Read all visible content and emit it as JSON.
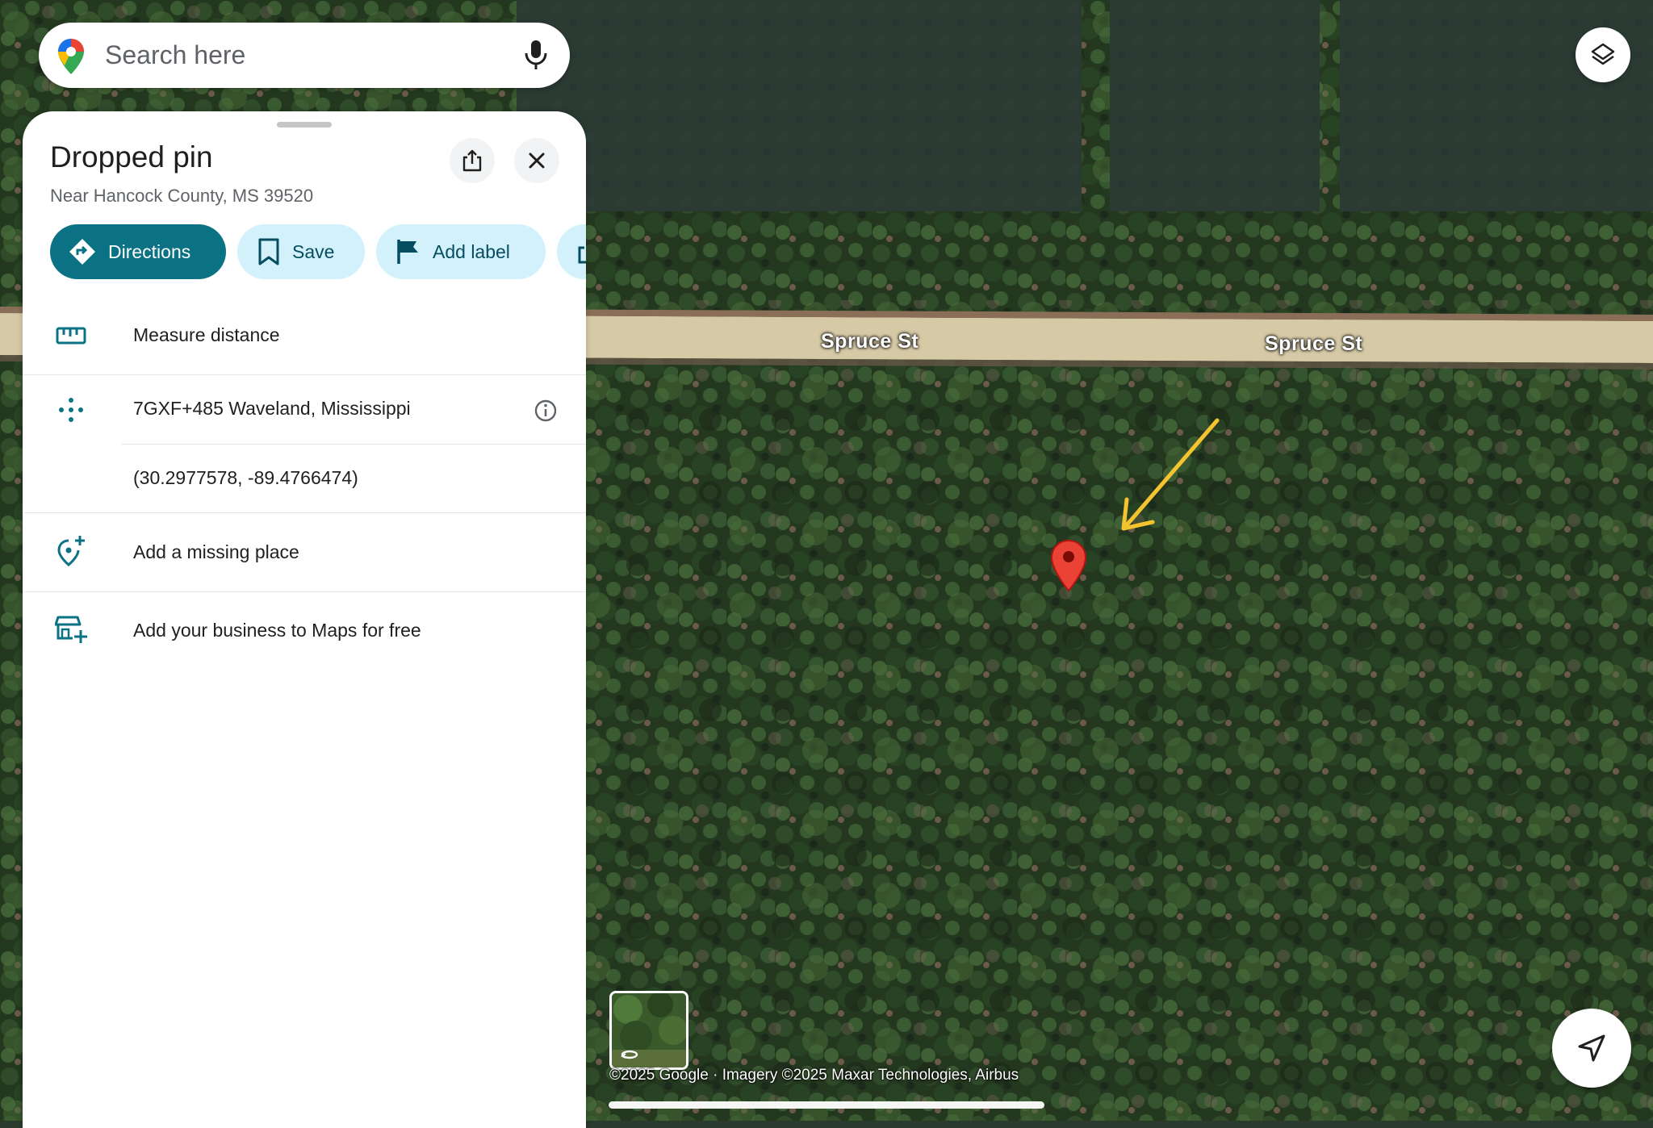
{
  "search": {
    "placeholder": "Search here"
  },
  "map": {
    "road_labels": [
      "Spruce St",
      "Spruce St"
    ],
    "attribution": "©2025 Google · Imagery ©2025 Maxar Technologies, Airbus",
    "annotation_color": "#f4c430",
    "pin_color": "#ea4335"
  },
  "panel": {
    "title": "Dropped pin",
    "subtitle": "Near Hancock County, MS 39520",
    "actions": {
      "directions": "Directions",
      "save": "Save",
      "add_label": "Add label"
    },
    "rows": {
      "measure": "Measure distance",
      "plus_code": "7GXF+485 Waveland, Mississippi",
      "coordinates": "(30.2977578, -89.4766474)",
      "add_place": "Add a missing place",
      "add_business": "Add your business to Maps for free"
    }
  },
  "colors": {
    "accent": "#0b7285",
    "chip_bg": "#d3f1fb",
    "chip_text": "#054d5f"
  },
  "icons": [
    "google-maps-logo-icon",
    "mic-icon",
    "layers-icon",
    "share-icon",
    "close-icon",
    "directions-icon",
    "bookmark-icon",
    "flag-icon",
    "ruler-icon",
    "plus-code-icon",
    "info-icon",
    "add-location-icon",
    "add-business-icon",
    "navigation-arrow-icon",
    "street-view-icon"
  ]
}
